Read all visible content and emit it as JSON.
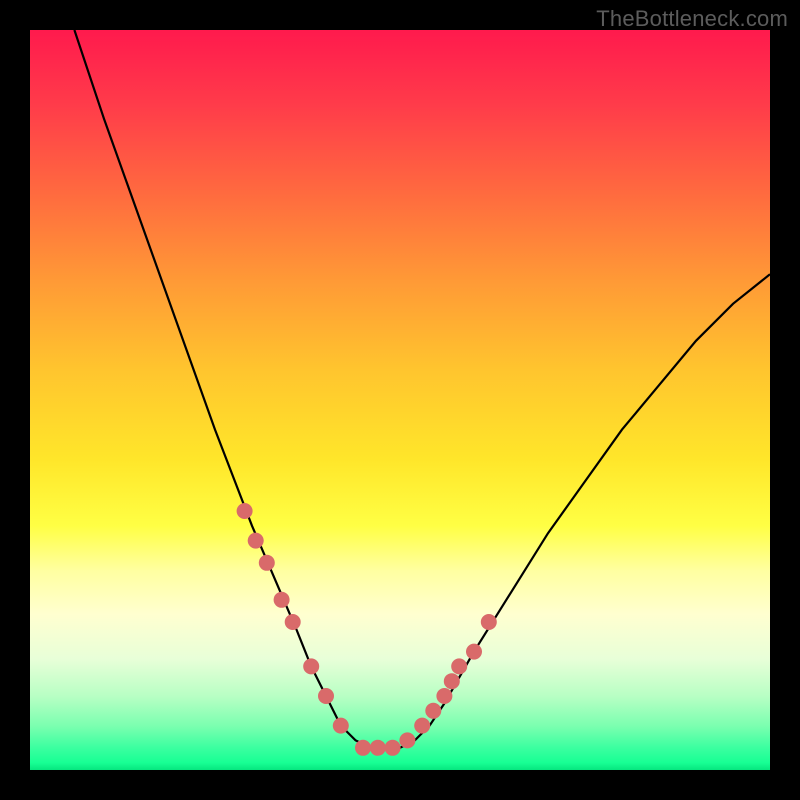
{
  "watermark": "TheBottleneck.com",
  "chart_data": {
    "type": "line",
    "title": "",
    "xlabel": "",
    "ylabel": "",
    "xlim": [
      0,
      100
    ],
    "ylim": [
      0,
      100
    ],
    "series": [
      {
        "name": "bottleneck-curve",
        "x": [
          6,
          10,
          15,
          20,
          25,
          30,
          33,
          36,
          38,
          40,
          42,
          44,
          46,
          48,
          50,
          52,
          54,
          56,
          60,
          65,
          70,
          75,
          80,
          85,
          90,
          95,
          100
        ],
        "y": [
          100,
          88,
          74,
          60,
          46,
          33,
          26,
          19,
          14,
          10,
          6,
          4,
          3,
          3,
          3,
          4,
          6,
          9,
          16,
          24,
          32,
          39,
          46,
          52,
          58,
          63,
          67
        ]
      }
    ],
    "markers": {
      "name": "highlighted-points",
      "color": "#d96a6a",
      "radius_px": 8,
      "x": [
        29,
        30.5,
        32,
        34,
        35.5,
        38,
        40,
        42,
        45,
        47,
        49,
        51,
        53,
        54.5,
        56,
        57,
        58,
        60,
        62
      ],
      "y": [
        35,
        31,
        28,
        23,
        20,
        14,
        10,
        6,
        3,
        3,
        3,
        4,
        6,
        8,
        10,
        12,
        14,
        16,
        20
      ]
    }
  }
}
